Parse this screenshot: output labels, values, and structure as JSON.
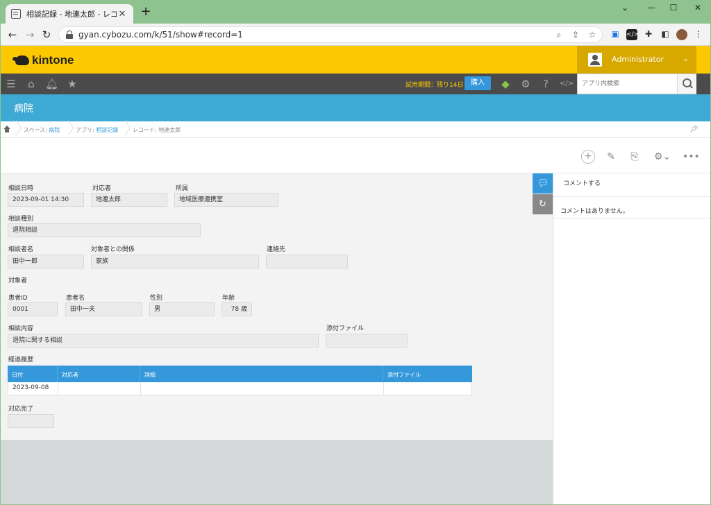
{
  "browser": {
    "tab_title": "相談記録 - 地連太郎 - レコードの詳",
    "url": "gyan.cybozu.com/k/51/show#record=1"
  },
  "header": {
    "logo": "kintone",
    "user": "Administrator"
  },
  "toolbar": {
    "trial": "試用期間：残り14日",
    "buy": "購入",
    "search_placeholder": "アプリ内検索"
  },
  "space": {
    "title": "病院"
  },
  "breadcrumb": {
    "space_label": "スペース: ",
    "space_link": "病院",
    "app_label": "アプリ: ",
    "app_link": "相談記録",
    "record": "レコード: 地連太郎"
  },
  "record": {
    "fields": {
      "consult_datetime_label": "相談日時",
      "consult_datetime": "2023-09-01 14:30",
      "handler_label": "対応者",
      "handler": "地連太郎",
      "department_label": "所属",
      "department": "地域医療連携室",
      "consult_type_label": "相談種別",
      "consult_type": "退院相談",
      "consultant_name_label": "相談者名",
      "consultant_name": "田中一郎",
      "relation_label": "対象者との関係",
      "relation": "家族",
      "contact_label": "連絡先",
      "contact": "",
      "subject_label": "対象者",
      "patient_id_label": "患者ID",
      "patient_id": "0001",
      "patient_name_label": "患者名",
      "patient_name": "田中一夫",
      "sex_label": "性別",
      "sex": "男",
      "age_label": "年齢",
      "age": "78 歳",
      "content_label": "相談内容",
      "content": "退院に関する相談",
      "attachment_label": "添付ファイル",
      "attachment": "",
      "history_label": "経過履歴",
      "completed_label": "対応完了",
      "completed": ""
    },
    "subtable": {
      "headers": [
        "日付",
        "対応者",
        "詳細",
        "添付ファイル"
      ],
      "rows": [
        [
          "2023-09-08",
          "",
          "",
          ""
        ]
      ]
    }
  },
  "comments": {
    "placeholder": "コメントする",
    "empty": "コメントはありません。"
  },
  "colors": {
    "kintone_yellow": "#fcc800",
    "space_blue": "#3fa9d5",
    "accent_blue": "#3498db",
    "toolbar_dark": "#4b4b4b"
  }
}
